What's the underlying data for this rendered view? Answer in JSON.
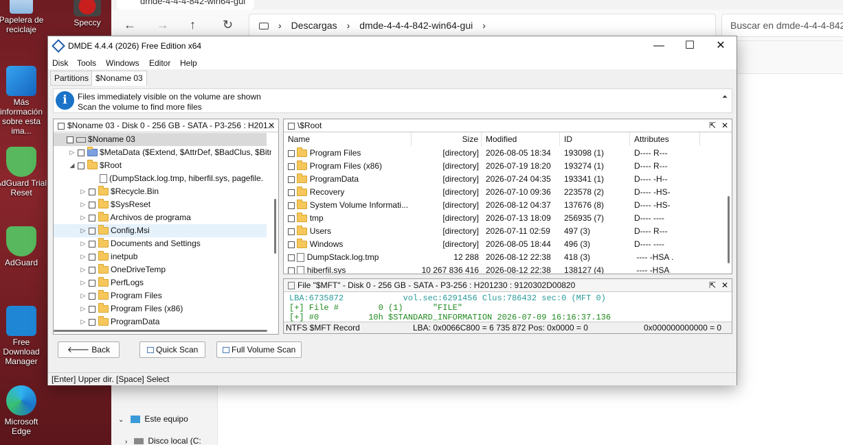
{
  "desktop": {
    "icons": [
      {
        "label": "Papelera de reciclaje"
      },
      {
        "label": "Speccy"
      },
      {
        "label": "Más información sobre esta ima..."
      },
      {
        "label": "AdGuard Trial Reset"
      },
      {
        "label": "AdGuard"
      },
      {
        "label": "Free Download Manager"
      },
      {
        "label": "Microsoft Edge"
      }
    ]
  },
  "explorer": {
    "tab_title": "dmde-4-4-4-842-win64-gui",
    "breadcrumb": [
      "Descargas",
      "dmde-4-4-4-842-win64-gui"
    ],
    "search_placeholder": "Buscar en dmde-4-4-4-842-wi",
    "nav": [
      {
        "label": "Este equipo"
      },
      {
        "label": "Disco local (C:"
      }
    ]
  },
  "dmde": {
    "title": "DMDE 4.4.4 (2026) Free Edition x64",
    "menu": [
      "Disk",
      "Tools",
      "Windows",
      "Editor",
      "Help"
    ],
    "tabs": [
      "Partitions",
      "$Noname 03"
    ],
    "info": {
      "line1": "Files immediately visible on the volume are shown",
      "line2": "Scan the volume to find more files"
    },
    "tree": {
      "header": "$Noname 03 - Disk 0 - 256 GB - SATA - P3-256 : H201...",
      "items": [
        {
          "label": "$Noname 03",
          "depth": 0,
          "icon": "drive",
          "tri": ""
        },
        {
          "label": "$MetaData ($Extend, $AttrDef, $BadClus, $Bitm",
          "depth": 1,
          "icon": "special-folder",
          "tri": "▷"
        },
        {
          "label": "$Root",
          "depth": 1,
          "icon": "folder",
          "tri": "◢"
        },
        {
          "label": "(DumpStack.log.tmp, hiberfil.sys, pagefile.",
          "depth": 2,
          "icon": "files",
          "tri": ""
        },
        {
          "label": "$Recycle.Bin",
          "depth": 2,
          "icon": "folder",
          "tri": "▷"
        },
        {
          "label": "$SysReset",
          "depth": 2,
          "icon": "folder",
          "tri": "▷"
        },
        {
          "label": "Archivos de programa",
          "depth": 2,
          "icon": "folder",
          "tri": "▷"
        },
        {
          "label": "Config.Msi",
          "depth": 2,
          "icon": "folder",
          "tri": "▷",
          "selected": true
        },
        {
          "label": "Documents and Settings",
          "depth": 2,
          "icon": "folder",
          "tri": "▷"
        },
        {
          "label": "inetpub",
          "depth": 2,
          "icon": "folder",
          "tri": "▷"
        },
        {
          "label": "OneDriveTemp",
          "depth": 2,
          "icon": "folder",
          "tri": "▷"
        },
        {
          "label": "PerfLogs",
          "depth": 2,
          "icon": "folder",
          "tri": "▷"
        },
        {
          "label": "Program Files",
          "depth": 2,
          "icon": "folder",
          "tri": "▷"
        },
        {
          "label": "Program Files (x86)",
          "depth": 2,
          "icon": "folder",
          "tri": "▷"
        },
        {
          "label": "ProgramData",
          "depth": 2,
          "icon": "folder",
          "tri": "▷"
        }
      ]
    },
    "files": {
      "header": "\\$Root",
      "columns": [
        "Name",
        "Size",
        "Modified",
        "ID",
        "Attributes"
      ],
      "rows": [
        {
          "name": "Program Files",
          "size": "[directory]",
          "modified": "2026-08-05 18:34",
          "id": "193098 (1)",
          "attr": "D---- R---",
          "icon": "folder"
        },
        {
          "name": "Program Files (x86)",
          "size": "[directory]",
          "modified": "2026-07-19 18:20",
          "id": "193274 (1)",
          "attr": "D---- R---",
          "icon": "folder"
        },
        {
          "name": "ProgramData",
          "size": "[directory]",
          "modified": "2026-07-24 04:35",
          "id": "193341 (1)",
          "attr": "D---- -H--",
          "icon": "folder"
        },
        {
          "name": "Recovery",
          "size": "[directory]",
          "modified": "2026-07-10 09:36",
          "id": "223578 (2)",
          "attr": "D---- -HS-",
          "icon": "folder"
        },
        {
          "name": "System Volume Informati...",
          "size": "[directory]",
          "modified": "2026-08-12 04:37",
          "id": "137676 (8)",
          "attr": "D---- -HS-",
          "icon": "folder"
        },
        {
          "name": "tmp",
          "size": "[directory]",
          "modified": "2026-07-13 18:09",
          "id": "256935 (7)",
          "attr": "D---- ----",
          "icon": "folder"
        },
        {
          "name": "Users",
          "size": "[directory]",
          "modified": "2026-07-11 02:59",
          "id": "497 (3)",
          "attr": "D---- R---",
          "icon": "folder"
        },
        {
          "name": "Windows",
          "size": "[directory]",
          "modified": "2026-08-05 18:44",
          "id": "496 (3)",
          "attr": "D---- ----",
          "icon": "folder"
        },
        {
          "name": "DumpStack.log.tmp",
          "size": "12 288",
          "modified": "2026-08-12 22:38",
          "id": "418 (3)",
          "attr": " ---- -HSA .",
          "icon": "file"
        },
        {
          "name": "hiberfil.sys",
          "size": "10 267 836 416",
          "modified": "2026-08-12 22:38",
          "id": "138127 (4)",
          "attr": " ---- -HSA",
          "icon": "file"
        }
      ]
    },
    "mft": {
      "header": "File \"$MFT\" - Disk 0 - 256 GB - SATA - P3-256 : H201230 : 9120302D00820",
      "lines": [
        "LBA:6735872            vol.sec:6291456 Clus:786432 sec:0 (MFT 0)",
        "[+] File #        0 (1)      \"FILE\"",
        "[+] #0          10h $STANDARD_INFORMATION 2026-07-09 16:16:37.136"
      ],
      "footer_left": "NTFS $MFT Record",
      "footer_mid": "LBA: 0x0066C800 = 6 735 872  Pos: 0x0000 = 0",
      "footer_right": "0x000000000000 = 0"
    },
    "buttons": {
      "back": "Back",
      "quick": "Quick Scan",
      "full": "Full Volume Scan"
    },
    "status": "[Enter] Upper dir.  [Space] Select"
  }
}
